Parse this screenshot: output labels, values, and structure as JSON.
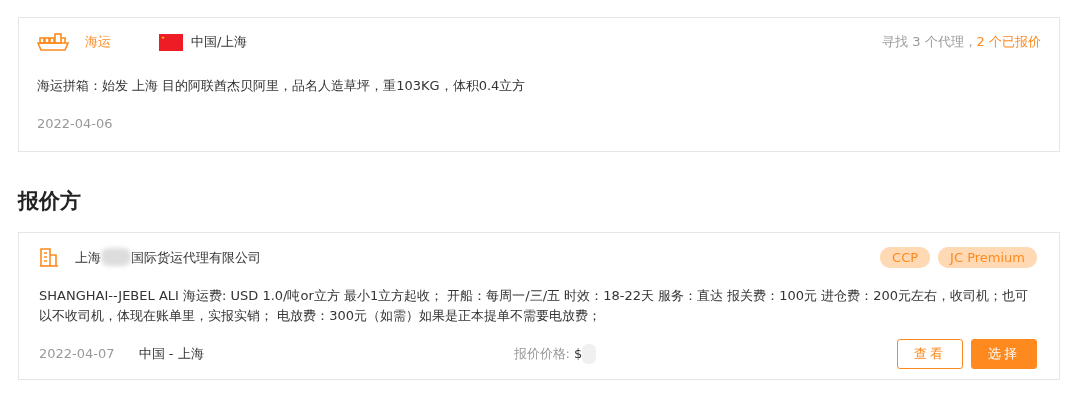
{
  "request": {
    "mode": "海运",
    "origin": "中国/上海",
    "summary_prefix": "寻找 3 个代理，",
    "summary_highlight": "2 个已报价",
    "description": "海运拼箱：始发 上海 目的阿联酋杰贝阿里，品名人造草坪，重103KG，体积0.4立方",
    "date": "2022-04-06"
  },
  "section_title": "报价方",
  "quotes": [
    {
      "company_start": "上海",
      "company_end": "国际货运代理有限公司",
      "tags": [
        "CCP",
        "JC Premium"
      ],
      "description": "SHANGHAI--JEBEL ALI 海运费: USD 1.0/吨or立方 最小1立方起收； 开船：每周一/三/五 时效：18-22天 服务：直达 报关费：100元 进仓费：200元左右，收司机；也可以不收司机，体现在账单里，实报实销； 电放费：300元（如需）如果是正本提单不需要电放费；",
      "date": "2022-04-07",
      "route": "中国 - 上海",
      "price_label": "报价价格:",
      "price_value": "$",
      "buttons": [
        {
          "label": "查看",
          "kind": "outline"
        },
        {
          "label": "选择",
          "kind": "solid"
        }
      ]
    }
  ]
}
